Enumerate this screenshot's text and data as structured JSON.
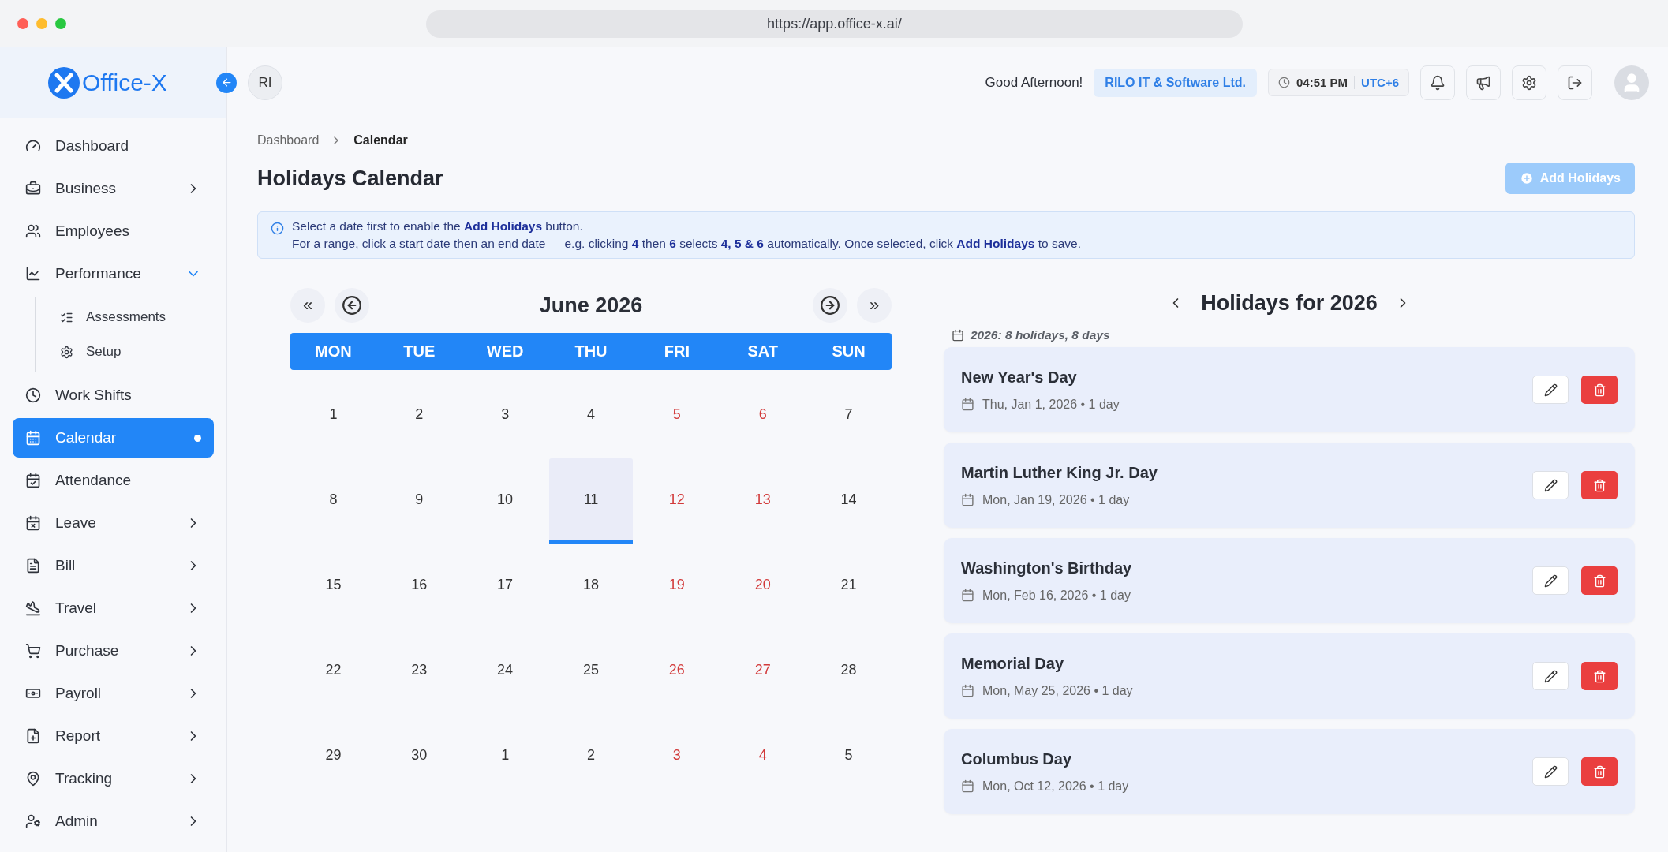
{
  "browser": {
    "url": "https://app.office-x.ai/"
  },
  "header": {
    "logo": "Office-X",
    "user_initials": "RI",
    "greeting": "Good Afternoon!",
    "company": "RILO IT & Software Ltd.",
    "time": "04:51 PM",
    "timezone": "UTC+6"
  },
  "sidebar": {
    "items": [
      {
        "label": "Dashboard",
        "selected": false
      },
      {
        "label": "Business",
        "selected": false,
        "expanded": false
      },
      {
        "label": "Employees",
        "selected": false
      },
      {
        "label": "Performance",
        "selected": false,
        "expanded": true,
        "children": [
          {
            "label": "Assessments",
            "selected": false
          },
          {
            "label": "Setup",
            "selected": false
          }
        ]
      },
      {
        "label": "Work Shifts",
        "selected": false
      },
      {
        "label": "Calendar",
        "selected": true
      },
      {
        "label": "Attendance",
        "selected": false
      },
      {
        "label": "Leave",
        "selected": false,
        "expanded": false
      },
      {
        "label": "Bill",
        "selected": false,
        "expanded": false
      },
      {
        "label": "Travel",
        "selected": false,
        "expanded": false
      },
      {
        "label": "Purchase",
        "selected": false,
        "expanded": false
      },
      {
        "label": "Payroll",
        "selected": false,
        "expanded": false
      },
      {
        "label": "Report",
        "selected": false,
        "expanded": false
      },
      {
        "label": "Tracking",
        "selected": false,
        "expanded": false
      },
      {
        "label": "Admin",
        "selected": false,
        "expanded": false
      }
    ]
  },
  "breadcrumb": [
    "Dashboard",
    "Calendar"
  ],
  "page_title": "Holidays Calendar",
  "add_button": {
    "label": "Add Holidays",
    "disabled": true
  },
  "info": [
    "Select a date first to enable the **Add Holidays** button.",
    "For a range, click a start date then an end date — e.g. clicking **4** then **6** selects **4, 5 & 6** automatically. Once selected, click **Add Holidays** to save."
  ],
  "calendar": {
    "month": "June 2026",
    "prev_year": "«",
    "next_year": "»",
    "weekdays": [
      "MON",
      "TUE",
      "WED",
      "THU",
      "FRI",
      "SAT",
      "SUN"
    ],
    "weeks": [
      [
        {
          "day": "1",
          "weekend": false,
          "selected": false
        },
        {
          "day": "2",
          "weekend": false,
          "selected": false
        },
        {
          "day": "3",
          "weekend": false,
          "selected": false
        },
        {
          "day": "4",
          "weekend": false,
          "selected": false
        },
        {
          "day": "5",
          "weekend": true,
          "selected": false
        },
        {
          "day": "6",
          "weekend": true,
          "selected": false
        },
        {
          "day": "7",
          "weekend": false,
          "selected": false
        }
      ],
      [
        {
          "day": "8",
          "weekend": false,
          "selected": false
        },
        {
          "day": "9",
          "weekend": false,
          "selected": false
        },
        {
          "day": "10",
          "weekend": false,
          "selected": false
        },
        {
          "day": "11",
          "weekend": false,
          "selected": true
        },
        {
          "day": "12",
          "weekend": true,
          "selected": false
        },
        {
          "day": "13",
          "weekend": true,
          "selected": false
        },
        {
          "day": "14",
          "weekend": false,
          "selected": false
        }
      ],
      [
        {
          "day": "15",
          "weekend": false,
          "selected": false
        },
        {
          "day": "16",
          "weekend": false,
          "selected": false
        },
        {
          "day": "17",
          "weekend": false,
          "selected": false
        },
        {
          "day": "18",
          "weekend": false,
          "selected": false
        },
        {
          "day": "19",
          "weekend": true,
          "selected": false
        },
        {
          "day": "20",
          "weekend": true,
          "selected": false
        },
        {
          "day": "21",
          "weekend": false,
          "selected": false
        }
      ],
      [
        {
          "day": "22",
          "weekend": false,
          "selected": false
        },
        {
          "day": "23",
          "weekend": false,
          "selected": false
        },
        {
          "day": "24",
          "weekend": false,
          "selected": false
        },
        {
          "day": "25",
          "weekend": false,
          "selected": false
        },
        {
          "day": "26",
          "weekend": true,
          "selected": false
        },
        {
          "day": "27",
          "weekend": true,
          "selected": false
        },
        {
          "day": "28",
          "weekend": false,
          "selected": false
        }
      ],
      [
        {
          "day": "29",
          "weekend": false,
          "selected": false
        },
        {
          "day": "30",
          "weekend": false,
          "selected": false
        },
        {
          "day": "1",
          "weekend": false,
          "selected": false
        },
        {
          "day": "2",
          "weekend": false,
          "selected": false
        },
        {
          "day": "3",
          "weekend": true,
          "selected": false
        },
        {
          "day": "4",
          "weekend": true,
          "selected": false
        },
        {
          "day": "5",
          "weekend": false,
          "selected": false
        }
      ]
    ]
  },
  "holidays": {
    "title": "Holidays for 2026",
    "summary": "2026: 8 holidays, 8 days",
    "items": [
      {
        "name": "New Year's Day",
        "date": "Thu, Jan 1, 2026 • 1 day"
      },
      {
        "name": "Martin Luther King Jr. Day",
        "date": "Mon, Jan 19, 2026 • 1 day"
      },
      {
        "name": "Washington's Birthday",
        "date": "Mon, Feb 16, 2026 • 1 day"
      },
      {
        "name": "Memorial Day",
        "date": "Mon, May 25, 2026 • 1 day"
      },
      {
        "name": "Columbus Day",
        "date": "Mon, Oct 12, 2026 • 1 day"
      }
    ]
  }
}
